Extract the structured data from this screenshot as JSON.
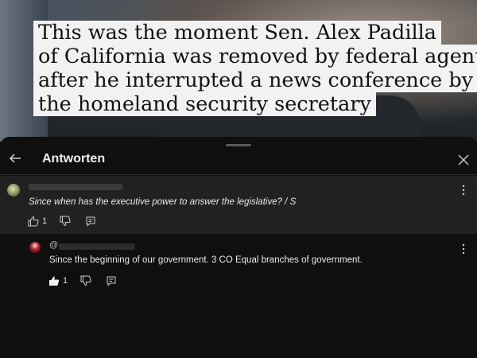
{
  "video": {
    "caption_lines": [
      "This was the moment Sen. Alex Padilla",
      "of California was removed by federal agents",
      "after he interrupted a news conference by",
      "the homeland security secretary"
    ]
  },
  "panel": {
    "title": "Antworten",
    "back_icon": "arrow-left-icon",
    "close_icon": "close-icon"
  },
  "comments": [
    {
      "handle_prefix": "",
      "text": "Since when has the executive power to answer the legislative? / S",
      "likes": "1",
      "liked": false
    },
    {
      "handle_prefix": "@",
      "text": "Since the beginning of our government. 3 CO Equal branches of government.",
      "likes": "1",
      "liked": true
    }
  ],
  "colors": {
    "background": "#0f0f0f",
    "highlighted_comment": "#212121",
    "text": "#eaeaea"
  }
}
